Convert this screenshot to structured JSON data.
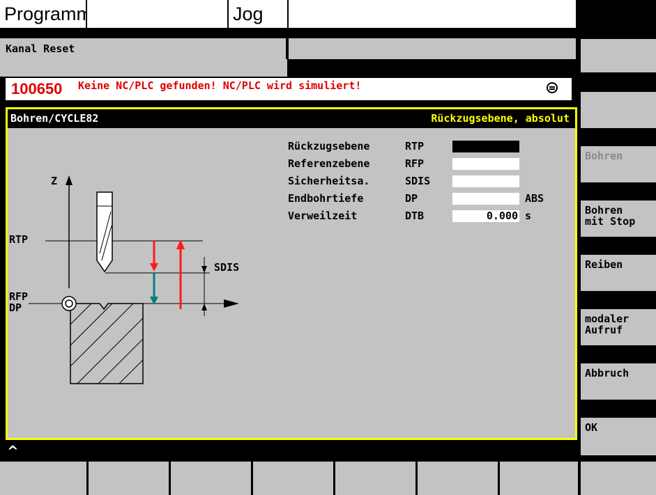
{
  "header": {
    "program_label": "Programm",
    "mode_label": "Jog",
    "channel_status": "Kanal Reset"
  },
  "alarm": {
    "number": "100650",
    "message": "Keine NC/PLC gefunden! NC/PLC wird simuliert!"
  },
  "dialog": {
    "title": "Bohren/CYCLE82",
    "field_hint": "Rückzugsebene, absolut",
    "params": [
      {
        "label": "Rückzugsebene",
        "code": "RTP",
        "value": "",
        "unit": ""
      },
      {
        "label": "Referenzebene",
        "code": "RFP",
        "value": "",
        "unit": ""
      },
      {
        "label": "Sicherheitsa.",
        "code": "SDIS",
        "value": "",
        "unit": ""
      },
      {
        "label": "Endbohrtiefe",
        "code": "DP",
        "value": "",
        "unit": "ABS"
      },
      {
        "label": "Verweilzeit",
        "code": "DTB",
        "value": "0.000",
        "unit": "s"
      }
    ],
    "diagram": {
      "axis_z": "Z",
      "rtp": "RTP",
      "sdis": "SDIS",
      "rfp": "RFP",
      "dp": "DP"
    }
  },
  "softkeys": [
    {
      "label": "",
      "enabled": true
    },
    {
      "label": "",
      "enabled": true
    },
    {
      "label": "Bohren",
      "enabled": false
    },
    {
      "label": "Bohren\nmit Stop",
      "enabled": true
    },
    {
      "label": "Reiben",
      "enabled": true
    },
    {
      "label": "modaler\nAufruf",
      "enabled": true
    },
    {
      "label": "Abbruch",
      "enabled": true
    },
    {
      "label": "OK",
      "enabled": true
    }
  ],
  "recall_symbol": "^",
  "colors": {
    "background": "#c3c3c3",
    "alarm": "#e00000",
    "highlight": "#ffff00",
    "arrow_red": "#ff1a1a",
    "arrow_teal": "#008080"
  }
}
